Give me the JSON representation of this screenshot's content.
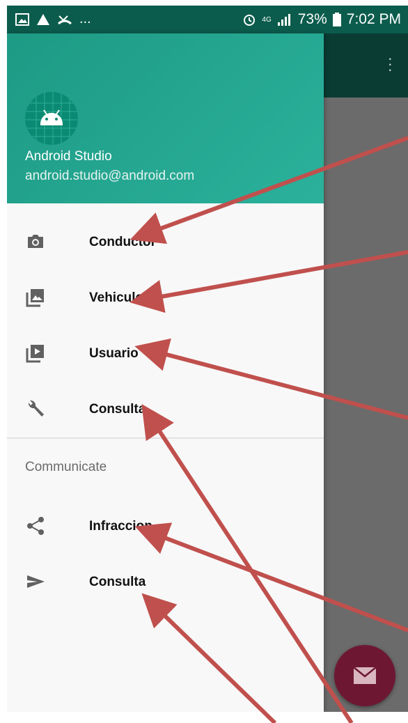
{
  "status_bar": {
    "more": "...",
    "network": "4G",
    "battery": "73%",
    "time": "7:02 PM"
  },
  "header": {
    "name": "Android Studio",
    "email": "android.studio@android.com"
  },
  "menu": {
    "items": [
      {
        "label": "Conductor",
        "icon": "camera-icon"
      },
      {
        "label": "Vehiculo",
        "icon": "gallery-icon"
      },
      {
        "label": "Usuario",
        "icon": "slideshow-icon"
      },
      {
        "label": "Consulta",
        "icon": "wrench-icon"
      }
    ]
  },
  "communicate": {
    "title": "Communicate",
    "items": [
      {
        "label": "Infraccion",
        "icon": "share-icon"
      },
      {
        "label": "Consulta",
        "icon": "send-icon"
      }
    ]
  },
  "colors": {
    "primary": "#2bb19c",
    "primary_dark": "#0b5c4c",
    "accent": "#6e1733",
    "annotation": "#c0504d"
  }
}
